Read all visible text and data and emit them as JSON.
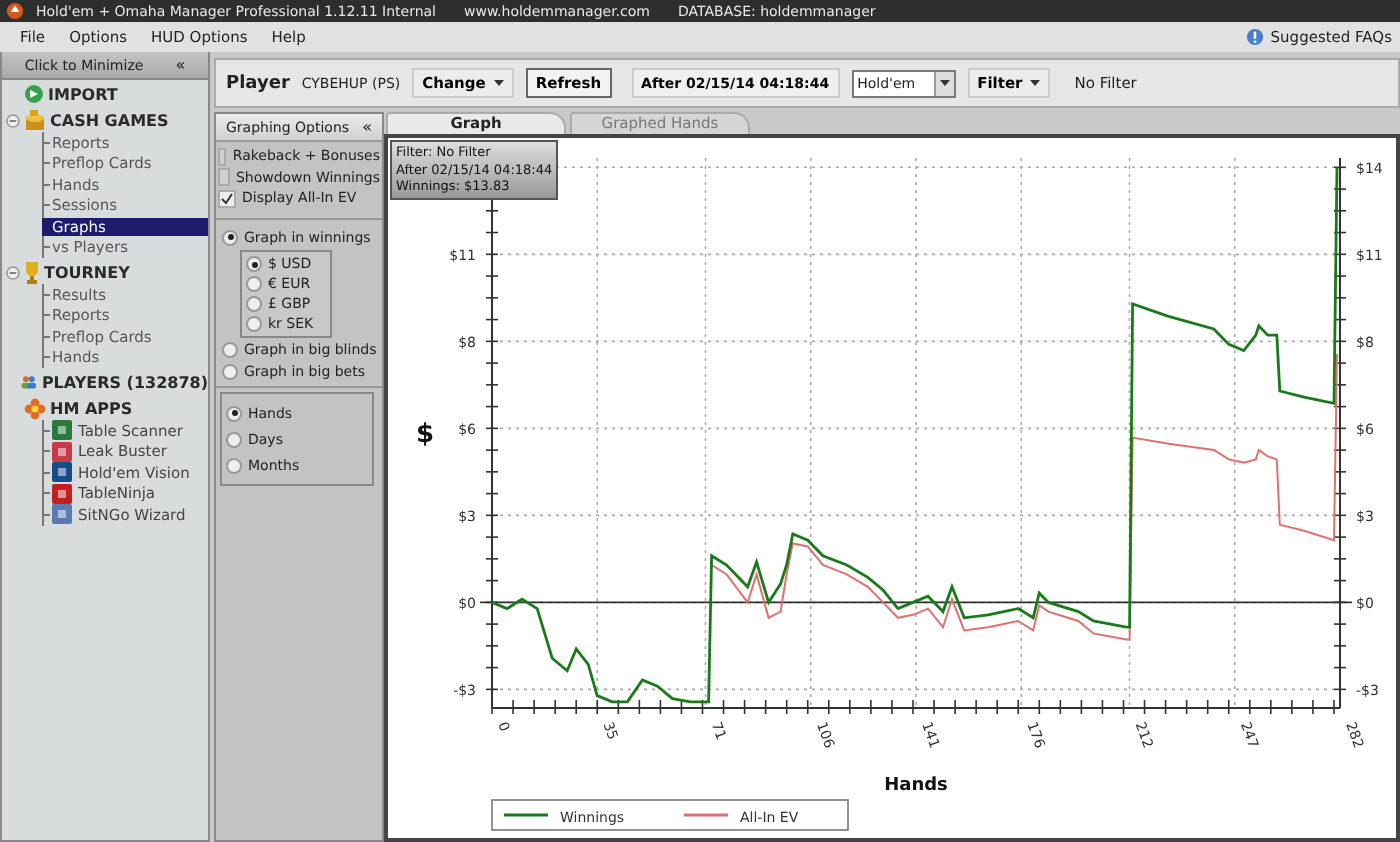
{
  "window": {
    "title": "Hold'em + Omaha Manager Professional 1.12.11 Internal",
    "url": "www.holdemmanager.com",
    "database": "DATABASE: holdemmanager"
  },
  "menu": [
    "File",
    "Options",
    "HUD Options",
    "Help"
  ],
  "help_link": "Suggested FAQs",
  "sidebar": {
    "minimize": "Click to Minimize",
    "collapse_glyph": "«",
    "sections": [
      {
        "label": "IMPORT"
      },
      {
        "label": "CASH GAMES",
        "expanded": true,
        "children": [
          {
            "label": "Reports",
            "selected": false
          },
          {
            "label": "Preflop Cards",
            "selected": false
          },
          {
            "label": "Hands",
            "selected": false
          },
          {
            "label": "Sessions",
            "selected": false
          },
          {
            "label": "Graphs",
            "selected": true
          },
          {
            "label": "vs Players",
            "selected": false
          }
        ]
      },
      {
        "label": "TOURNEY",
        "expanded": true,
        "children": [
          {
            "label": "Results",
            "selected": false
          },
          {
            "label": "Reports",
            "selected": false
          },
          {
            "label": "Preflop Cards",
            "selected": false
          },
          {
            "label": "Hands",
            "selected": false
          }
        ]
      },
      {
        "label": "PLAYERS (132878)"
      },
      {
        "label": "HM APPS",
        "children": [
          {
            "label": "Table Scanner",
            "selected": false
          },
          {
            "label": "Leak Buster",
            "selected": false
          },
          {
            "label": "Hold'em Vision",
            "selected": false
          },
          {
            "label": "TableNinja",
            "selected": false
          },
          {
            "label": "SitNGo Wizard",
            "selected": false
          }
        ]
      }
    ]
  },
  "toolbar": {
    "player_label": "Player",
    "player": "CYBEHUP (PS)",
    "change": "Change",
    "refresh": "Refresh",
    "date_filter": "After 02/15/14 04:18:44",
    "game": "Hold'em",
    "filter": "Filter",
    "filter_value": "No Filter"
  },
  "options": {
    "title": "Graphing Options",
    "collapse_glyph": "«",
    "checkboxes": [
      {
        "label": "Rakeback + Bonuses",
        "checked": false
      },
      {
        "label": "Showdown Winnings",
        "checked": false
      },
      {
        "label": "Display All-In EV",
        "checked": true
      }
    ],
    "units": [
      {
        "label": "Graph in winnings",
        "selected": true
      },
      {
        "label": "Graph in big blinds",
        "selected": false
      },
      {
        "label": "Graph in big bets",
        "selected": false
      }
    ],
    "currencies": [
      {
        "label": "$ USD",
        "selected": true
      },
      {
        "label": "€ EUR",
        "selected": false
      },
      {
        "label": "£ GBP",
        "selected": false
      },
      {
        "label": "kr SEK",
        "selected": false
      }
    ],
    "x_axis": [
      {
        "label": "Hands",
        "selected": true
      },
      {
        "label": "Days",
        "selected": false
      },
      {
        "label": "Months",
        "selected": false
      }
    ]
  },
  "tabs": [
    {
      "label": "Graph",
      "selected": true
    },
    {
      "label": "Graphed Hands",
      "selected": false
    }
  ],
  "graph": {
    "info": [
      "Filter: No Filter",
      "After 02/15/14 04:18:44",
      "Winnings: $13.83"
    ],
    "chart_data": {
      "type": "line",
      "xlabel": "Hands",
      "ylabel": "$",
      "x": [
        0,
        5,
        10,
        15,
        20,
        25,
        28,
        32,
        35,
        40,
        45,
        50,
        55,
        60,
        66,
        72,
        73,
        78,
        85,
        88,
        92,
        96,
        98,
        100,
        105,
        110,
        118,
        125,
        130,
        135,
        140,
        145,
        150,
        153,
        157,
        165,
        175,
        180,
        182,
        185,
        195,
        200,
        211,
        212,
        213,
        225,
        240,
        245,
        250,
        254,
        255,
        258,
        261,
        262,
        270,
        280,
        281
      ],
      "series": [
        {
          "name": "Winnings",
          "color": "#1a7a1a",
          "values": [
            0,
            -0.2,
            0.1,
            -0.2,
            -1.8,
            -2.2,
            -1.5,
            -2.0,
            -3.0,
            -3.2,
            -3.2,
            -2.5,
            -2.7,
            -3.1,
            -3.2,
            -3.2,
            1.5,
            1.2,
            0.5,
            1.3,
            0,
            0.6,
            1.2,
            2.2,
            2.0,
            1.5,
            1.2,
            0.8,
            0.4,
            -0.2,
            0,
            0.2,
            -0.3,
            0.5,
            -0.5,
            -0.4,
            -0.2,
            -0.5,
            0.3,
            0.0,
            -0.3,
            -0.6,
            -0.8,
            -0.8,
            9.6,
            9.2,
            8.8,
            8.3,
            8.1,
            8.6,
            8.9,
            8.6,
            8.6,
            6.8,
            6.6,
            6.4,
            14
          ]
        },
        {
          "name": "All-In EV",
          "color": "#e07070",
          "values": [
            null,
            null,
            null,
            null,
            null,
            null,
            null,
            null,
            null,
            null,
            null,
            null,
            null,
            null,
            null,
            null,
            1.2,
            0.9,
            0.0,
            0.9,
            -0.5,
            -0.3,
            0.9,
            1.9,
            1.8,
            1.2,
            0.9,
            0.5,
            0.0,
            -0.5,
            -0.4,
            -0.2,
            -0.8,
            0.1,
            -0.9,
            -0.8,
            -0.6,
            -0.9,
            -0.1,
            -0.3,
            -0.6,
            -1.0,
            -1.2,
            -1.2,
            5.3,
            5.1,
            4.9,
            4.6,
            4.5,
            4.6,
            4.9,
            4.7,
            4.6,
            2.5,
            2.3,
            2.0,
            8.0
          ]
        }
      ],
      "grid": true,
      "legend": "bottom",
      "xlim": [
        0,
        282
      ],
      "ylim": [
        -3.4,
        14.3
      ],
      "xticks": [
        0,
        35,
        71,
        106,
        141,
        176,
        212,
        247,
        282
      ],
      "yticks": [
        {
          "value": -2.8,
          "label": "-$3"
        },
        {
          "value": 0,
          "label": "$0"
        },
        {
          "value": 2.8,
          "label": "$3"
        },
        {
          "value": 5.6,
          "label": "$6"
        },
        {
          "value": 8.4,
          "label": "$8"
        },
        {
          "value": 11.2,
          "label": "$11"
        },
        {
          "value": 14,
          "label": "$14"
        }
      ]
    }
  }
}
